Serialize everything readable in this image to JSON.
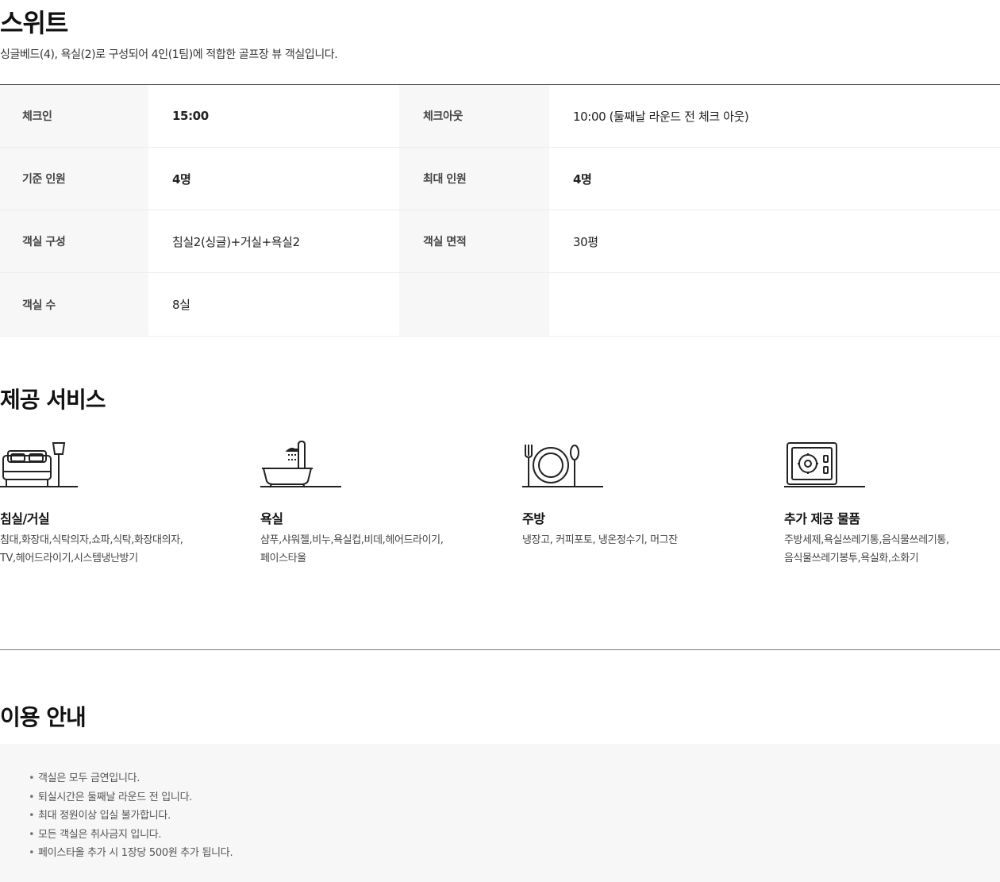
{
  "room": {
    "title": "스위트",
    "description": "싱글베드(4), 욕실(2)로 구성되어 4인(1팀)에 적합한 골프장 뷰 객실입니다."
  },
  "info": {
    "checkin_label": "체크인",
    "checkin_value": "15:00",
    "checkout_label": "체크아웃",
    "checkout_value": "10:00 (둘째날 라운드 전 체크 아웃)",
    "standard_label": "기준 인원",
    "standard_value": "4명",
    "max_label": "최대 인원",
    "max_value": "4명",
    "composition_label": "객실 구성",
    "composition_value": "침실2(싱글)+거실+욕실2",
    "area_label": "객실 면적",
    "area_value": "30평",
    "count_label": "객실 수",
    "count_value": "8실"
  },
  "services": {
    "title": "제공 서비스",
    "items": [
      {
        "icon": "bed-lamp-icon",
        "name": "침실/거실",
        "lines": [
          "침대,화장대,식탁의자,쇼파,식탁,화장대의자,",
          "TV,헤어드라이기,시스템냉난방기"
        ]
      },
      {
        "icon": "bathtub-icon",
        "name": "욕실",
        "lines": [
          "샴푸,샤워젤,비누,욕실컵,비데,헤어드라이기,",
          "페이스타올"
        ]
      },
      {
        "icon": "plate-cutlery-icon",
        "name": "주방",
        "lines": [
          "냉장고, 커피포토, 냉온정수기, 머그잔"
        ]
      },
      {
        "icon": "safe-icon",
        "name": "추가 제공 물품",
        "lines": [
          "주방세제,욕실쓰레기통,음식물쓰레기통,",
          "음식물쓰레기봉투,욕실화,소화기"
        ]
      }
    ]
  },
  "guide": {
    "title": "이용 안내",
    "bullet": "•",
    "items": [
      "객실은 모두 금연입니다.",
      "퇴실시간은  둘째날 라운드 전 입니다.",
      "최대 정원이상 입실 불가합니다.",
      "모든 객실은 취사금지 입니다.",
      "페이스타올 추가 시 1장당 500원 추가 됩니다."
    ]
  }
}
